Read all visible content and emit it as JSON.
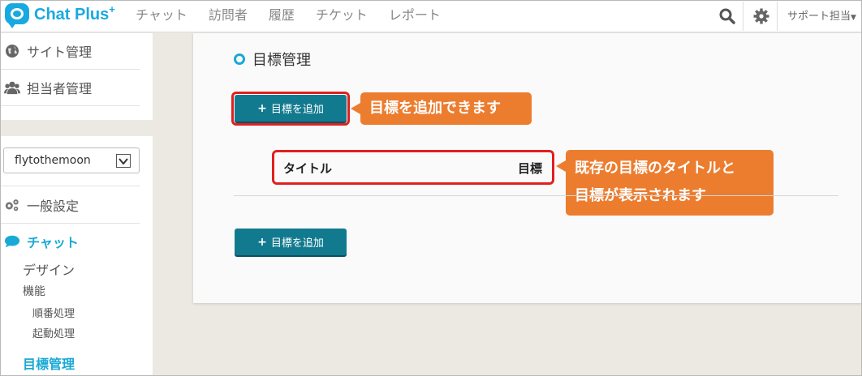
{
  "header": {
    "logo_text": "Chat Plus",
    "logo_sup": "+",
    "nav": [
      "チャット",
      "訪問者",
      "履歴",
      "チケット",
      "レポート"
    ],
    "support_label": "サポート担当"
  },
  "sidebar": {
    "site_admin": "サイト管理",
    "staff_admin": "担当者管理",
    "site_select_value": "flytothemoon",
    "general_settings": "一般設定",
    "chat_label": "チャット",
    "design": "デザイン",
    "features": "機能",
    "sequential": "順番処理",
    "startup": "起動処理",
    "goal_admin": "目標管理"
  },
  "main": {
    "title": "目標管理",
    "add_button_label": "目標を追加",
    "table_headers": [
      "タイトル",
      "目標"
    ],
    "callout_add": "目標を追加できます",
    "callout_table_line1": "既存の目標のタイトルと",
    "callout_table_line2": "目標が表示されます"
  },
  "colors": {
    "accent": "#19a9d5",
    "button": "#127a8f",
    "callout": "#ec7d2f",
    "highlight": "#e02020"
  }
}
